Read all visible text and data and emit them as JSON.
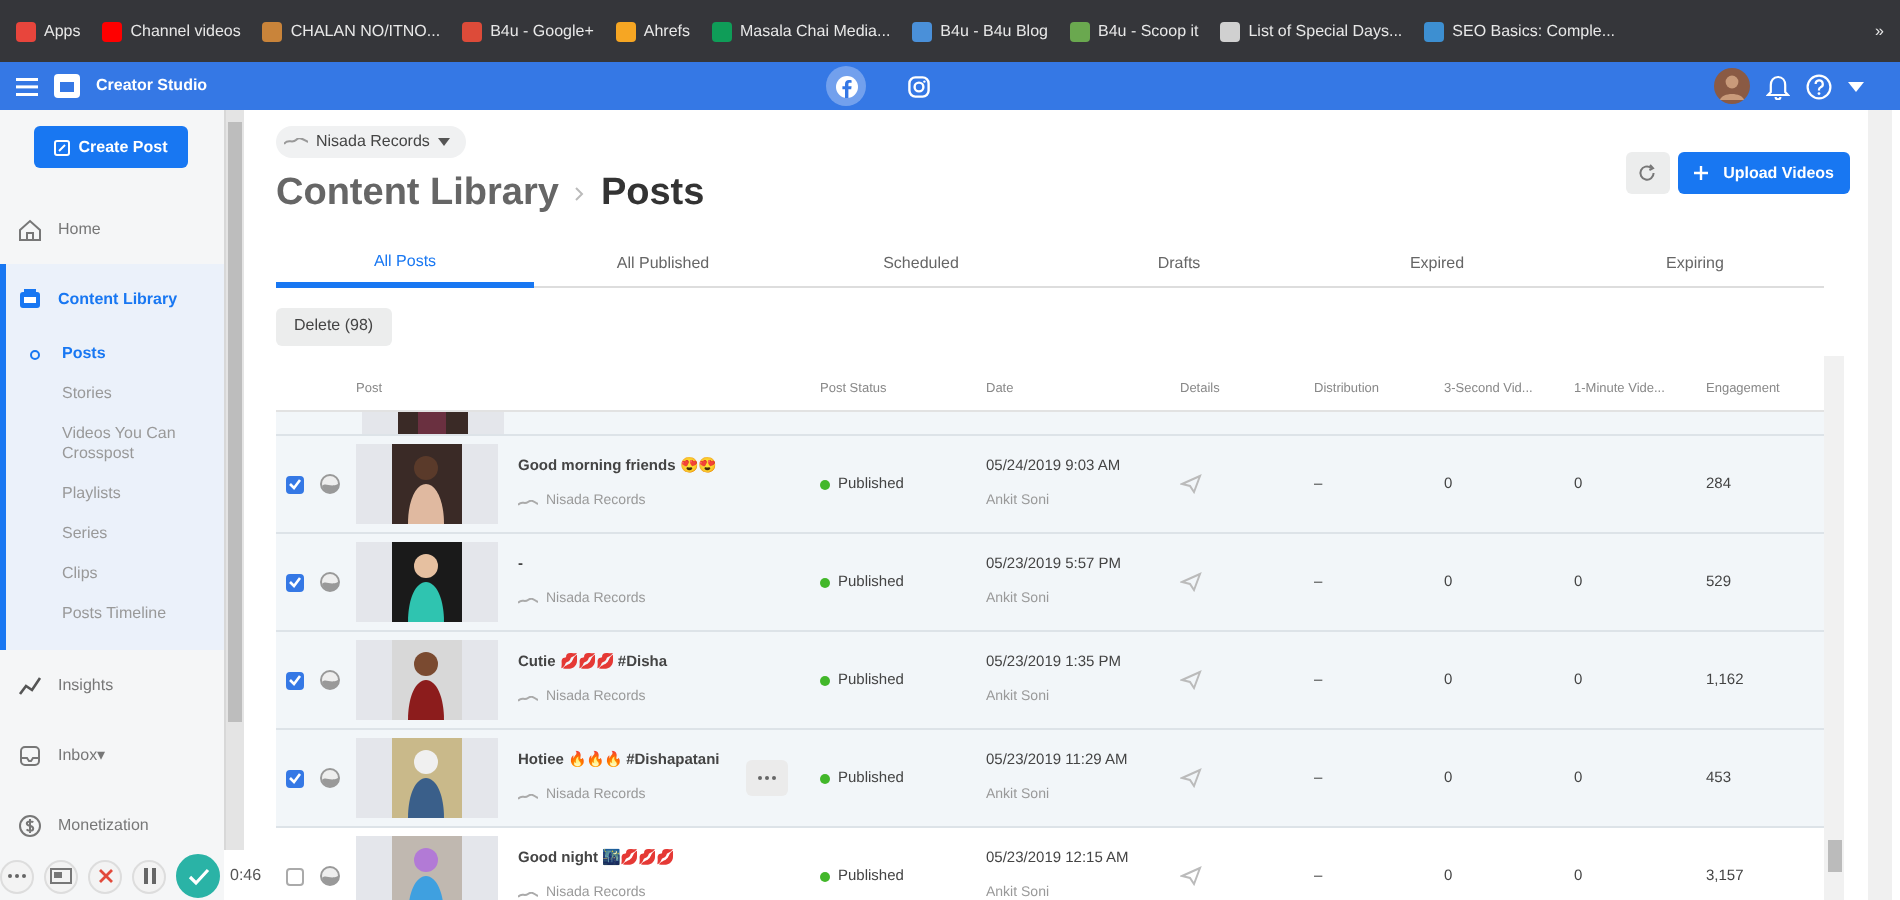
{
  "bookmarks": [
    {
      "label": "Apps",
      "color": "#e8453c"
    },
    {
      "label": "Channel videos",
      "color": "#ff0000"
    },
    {
      "label": "CHALAN NO/ITNO...",
      "color": "#c9843a"
    },
    {
      "label": "B4u - Google+",
      "color": "#dd4b39"
    },
    {
      "label": "Ahrefs",
      "color": "#f6a623"
    },
    {
      "label": "Masala Chai Media...",
      "color": "#0f9d58"
    },
    {
      "label": "B4u - B4u Blog",
      "color": "#4a90d9"
    },
    {
      "label": "B4u - Scoop it",
      "color": "#6aa84f"
    },
    {
      "label": "List of Special Days...",
      "color": "#d0d0d0"
    },
    {
      "label": "SEO Basics: Comple...",
      "color": "#3d8fd1"
    }
  ],
  "bookmarks_more": "»",
  "header": {
    "title": "Creator Studio",
    "platforms": [
      {
        "kind": "facebook",
        "selected": true
      },
      {
        "kind": "instagram",
        "selected": false
      }
    ]
  },
  "sidebar": {
    "create_button": "Create Post",
    "items": [
      {
        "label": "Home",
        "kind": "home",
        "selected": false,
        "expanded": false
      },
      {
        "label": "Content Library",
        "kind": "library",
        "selected": true,
        "expanded": true,
        "children": [
          {
            "label": "Posts",
            "selected": true
          },
          {
            "label": "Stories",
            "selected": false
          },
          {
            "label": "Videos You Can Crosspost",
            "selected": false
          },
          {
            "label": "Playlists",
            "selected": false
          },
          {
            "label": "Series",
            "selected": false
          },
          {
            "label": "Clips",
            "selected": false
          },
          {
            "label": "Posts Timeline",
            "selected": false
          }
        ]
      },
      {
        "label": "Insights",
        "kind": "insights",
        "selected": false,
        "expanded": false
      },
      {
        "label": "Inbox",
        "kind": "inbox",
        "selected": false,
        "expanded": false,
        "caret": "▾"
      },
      {
        "label": "Monetization",
        "kind": "money",
        "selected": false,
        "expanded": false
      }
    ]
  },
  "page_selector": "Nisada Records",
  "breadcrumb": [
    "Content Library",
    "Posts"
  ],
  "upload_button": "Upload Videos",
  "tabs": [
    {
      "label": "All Posts",
      "selected": true
    },
    {
      "label": "All Published",
      "selected": false
    },
    {
      "label": "Scheduled",
      "selected": false
    },
    {
      "label": "Drafts",
      "selected": false
    },
    {
      "label": "Expired",
      "selected": false
    },
    {
      "label": "Expiring",
      "selected": false
    }
  ],
  "delete_button": "Delete (98)",
  "table": {
    "columns": [
      "Post",
      "Post Status",
      "Date",
      "Details",
      "Distribution",
      "3-Second Vid...",
      "1-Minute Vide...",
      "Engagement"
    ],
    "rows": [
      {
        "checked": true,
        "title": "Good morning friends 😍😍",
        "page": "Nisada Records",
        "status": "Published",
        "date": "05/24/2019 9:03 AM",
        "author": "Ankit Soni",
        "distribution": "–",
        "views_3s": "0",
        "views_1m": "0",
        "engagement": "284",
        "more_menu": false
      },
      {
        "checked": true,
        "title": "-",
        "page": "Nisada Records",
        "status": "Published",
        "date": "05/23/2019 5:57 PM",
        "author": "Ankit Soni",
        "distribution": "–",
        "views_3s": "0",
        "views_1m": "0",
        "engagement": "529",
        "more_menu": false
      },
      {
        "checked": true,
        "title": "Cutie 💋💋💋 #Disha",
        "page": "Nisada Records",
        "status": "Published",
        "date": "05/23/2019 1:35 PM",
        "author": "Ankit Soni",
        "distribution": "–",
        "views_3s": "0",
        "views_1m": "0",
        "engagement": "1,162",
        "more_menu": false
      },
      {
        "checked": true,
        "title": "Hotiee 🔥🔥🔥 #Dishapatani",
        "page": "Nisada Records",
        "status": "Published",
        "date": "05/23/2019 11:29 AM",
        "author": "Ankit Soni",
        "distribution": "–",
        "views_3s": "0",
        "views_1m": "0",
        "engagement": "453",
        "more_menu": true
      },
      {
        "checked": false,
        "title": "Good night 🌃💋💋💋",
        "page": "Nisada Records",
        "status": "Published",
        "date": "05/23/2019 12:15 AM",
        "author": "Ankit Soni",
        "distribution": "–",
        "views_3s": "0",
        "views_1m": "0",
        "engagement": "3,157",
        "more_menu": false
      }
    ]
  },
  "recorder": {
    "time": "0:46"
  }
}
